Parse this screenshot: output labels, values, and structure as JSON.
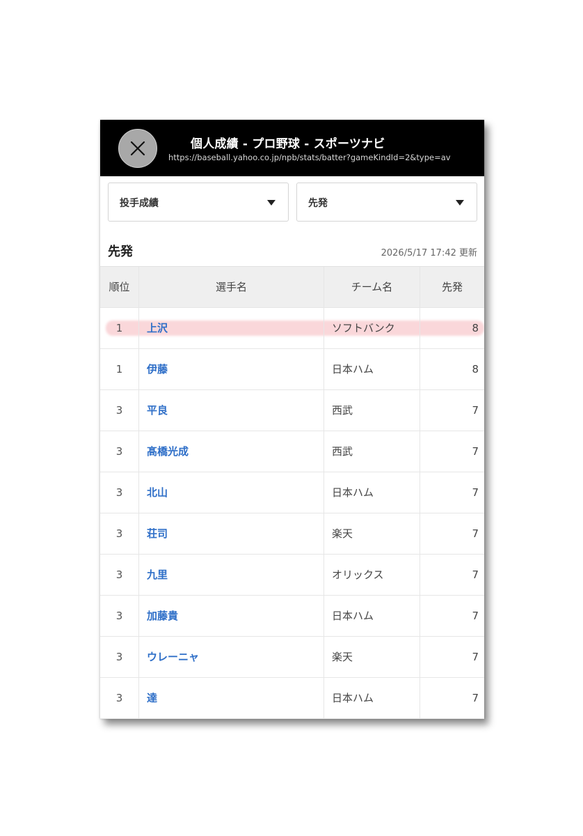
{
  "header": {
    "title": "個人成績 - プロ野球 - スポーツナビ",
    "url": "https://baseball.yahoo.co.jp/npb/stats/batter?gameKindId=2&type=av"
  },
  "filters": {
    "category": "投手成績",
    "stat": "先発"
  },
  "section": {
    "title": "先発",
    "updated": "2026/5/17 17:42 更新"
  },
  "table": {
    "columns": [
      "順位",
      "選手名",
      "チーム名",
      "先発"
    ],
    "rows": [
      {
        "rank": "1",
        "name": "上沢",
        "team": "ソフトバンク",
        "starts": "8"
      },
      {
        "rank": "1",
        "name": "伊藤",
        "team": "日本ハム",
        "starts": "8"
      },
      {
        "rank": "3",
        "name": "平良",
        "team": "西武",
        "starts": "7"
      },
      {
        "rank": "3",
        "name": "髙橋光成",
        "team": "西武",
        "starts": "7"
      },
      {
        "rank": "3",
        "name": "北山",
        "team": "日本ハム",
        "starts": "7"
      },
      {
        "rank": "3",
        "name": "荘司",
        "team": "楽天",
        "starts": "7"
      },
      {
        "rank": "3",
        "name": "九里",
        "team": "オリックス",
        "starts": "7"
      },
      {
        "rank": "3",
        "name": "加藤貴",
        "team": "日本ハム",
        "starts": "7"
      },
      {
        "rank": "3",
        "name": "ウレーニャ",
        "team": "楽天",
        "starts": "7"
      },
      {
        "rank": "3",
        "name": "達",
        "team": "日本ハム",
        "starts": "7"
      }
    ]
  },
  "colors": {
    "link": "#2f6fc8",
    "highlight": "#f0828c",
    "topbar": "#000000"
  },
  "icons": {
    "close": "close-icon",
    "dropdown": "caret-down-icon"
  }
}
